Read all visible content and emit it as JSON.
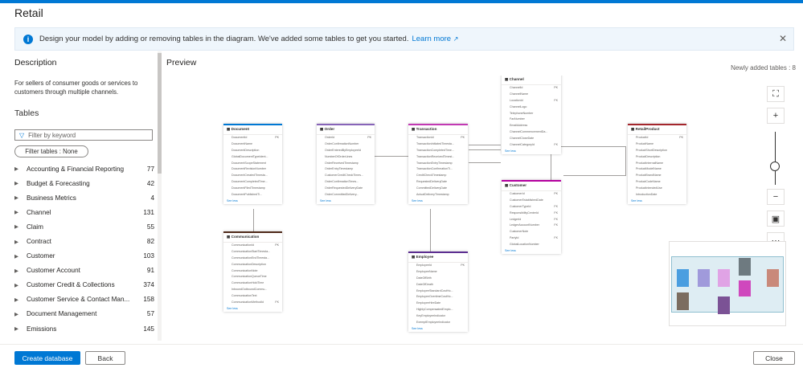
{
  "window": {
    "title": "Retail"
  },
  "banner": {
    "text": "Design your model by adding or removing tables in the diagram. We've added some tables to get you started.",
    "link": "Learn more",
    "link_icon": "external-link-icon",
    "close": "✕"
  },
  "description": {
    "heading": "Description",
    "text": "For sellers of consumer goods or services to customers through multiple channels."
  },
  "tables": {
    "heading": "Tables",
    "filter_placeholder": "Filter by keyword",
    "filter_pill": "Filter tables : None",
    "items": [
      {
        "name": "Accounting & Financial Reporting",
        "count": "77"
      },
      {
        "name": "Budget & Forecasting",
        "count": "42"
      },
      {
        "name": "Business Metrics",
        "count": "4"
      },
      {
        "name": "Channel",
        "count": "131"
      },
      {
        "name": "Claim",
        "count": "55"
      },
      {
        "name": "Contract",
        "count": "82"
      },
      {
        "name": "Customer",
        "count": "103"
      },
      {
        "name": "Customer Account",
        "count": "91"
      },
      {
        "name": "Customer Credit & Collections",
        "count": "374"
      },
      {
        "name": "Customer Service & Contact Man...",
        "count": "158"
      },
      {
        "name": "Document Management",
        "count": "57"
      },
      {
        "name": "Emissions",
        "count": "145"
      }
    ]
  },
  "preview": {
    "heading": "Preview",
    "newly_added": "Newly added tables : 8",
    "see_less": "See less",
    "cards": {
      "document": {
        "title": "Document",
        "fields": [
          {
            "n": "DocumentId",
            "k": "PK"
          },
          {
            "n": "DocumentName",
            "k": ""
          },
          {
            "n": "DocumentDescription",
            "k": ""
          },
          {
            "n": "GlobalDocumentTypeIdent...",
            "k": ""
          },
          {
            "n": "DocumentScopeStatement",
            "k": ""
          },
          {
            "n": "DocumentRevisionNumber",
            "k": ""
          },
          {
            "n": "DocumentCreatedTimesta...",
            "k": ""
          },
          {
            "n": "DocumentCompletedTime...",
            "k": ""
          },
          {
            "n": "DocumentFiledTimestamp",
            "k": ""
          },
          {
            "n": "DocumentPublishedTi...",
            "k": ""
          }
        ]
      },
      "order": {
        "title": "Order",
        "fields": [
          {
            "n": "OrderId",
            "k": "PK"
          },
          {
            "n": "OrderConfirmationNumber",
            "k": ""
          },
          {
            "n": "OrderEnteredByEmployeeId",
            "k": ""
          },
          {
            "n": "NumberOfOrderLines",
            "k": ""
          },
          {
            "n": "OrderReceivedTimestamp",
            "k": ""
          },
          {
            "n": "OrderEntryTimestamp",
            "k": ""
          },
          {
            "n": "CustomerCreditCheckTimes...",
            "k": ""
          },
          {
            "n": "OrderConfirmationTimes...",
            "k": ""
          },
          {
            "n": "OrderRequestedDeliveryDate",
            "k": ""
          },
          {
            "n": "OrderCommittedDelivery...",
            "k": ""
          }
        ]
      },
      "transaction": {
        "title": "Transaction",
        "fields": [
          {
            "n": "TransactionId",
            "k": "PK"
          },
          {
            "n": "TransactionInitiatedTimesta...",
            "k": ""
          },
          {
            "n": "TransactionCompletedTime...",
            "k": ""
          },
          {
            "n": "TransactionReceivedTimest...",
            "k": ""
          },
          {
            "n": "TransactionEntryTimestamp",
            "k": ""
          },
          {
            "n": "TransactionConfirmationTi...",
            "k": ""
          },
          {
            "n": "CreditCheckTimestamp",
            "k": ""
          },
          {
            "n": "RequestedDeliveryDate",
            "k": ""
          },
          {
            "n": "CommittedDeliveryDate",
            "k": ""
          },
          {
            "n": "ActualDeliveryTimestamp",
            "k": ""
          }
        ]
      },
      "channel": {
        "title": "Channel",
        "fields": [
          {
            "n": "ChannelId",
            "k": "PK"
          },
          {
            "n": "ChannelName",
            "k": ""
          },
          {
            "n": "LocationId",
            "k": "FK"
          },
          {
            "n": "ChannelLogo",
            "k": ""
          },
          {
            "n": "TelephoneNumber",
            "k": ""
          },
          {
            "n": "FaxNumber",
            "k": ""
          },
          {
            "n": "EmailAddress",
            "k": ""
          },
          {
            "n": "ChannelCommencementDa...",
            "k": ""
          },
          {
            "n": "ChannelCloseDate",
            "k": ""
          },
          {
            "n": "ChannelCategoryId",
            "k": "FK"
          }
        ]
      },
      "retailproduct": {
        "title": "RetailProduct",
        "fields": [
          {
            "n": "ProductId",
            "k": "PK"
          },
          {
            "n": "ProductName",
            "k": ""
          },
          {
            "n": "ProductShortDescription",
            "k": ""
          },
          {
            "n": "ProductDescription",
            "k": ""
          },
          {
            "n": "ProductInternalName",
            "k": ""
          },
          {
            "n": "ProductModelName",
            "k": ""
          },
          {
            "n": "ProductBrandName",
            "k": ""
          },
          {
            "n": "ProductCodeName",
            "k": ""
          },
          {
            "n": "ProductIntendedUse",
            "k": ""
          },
          {
            "n": "IntroductionDate",
            "k": ""
          }
        ]
      },
      "customer": {
        "title": "Customer",
        "fields": [
          {
            "n": "CustomerId",
            "k": "PK"
          },
          {
            "n": "CustomerEstablishedDate",
            "k": ""
          },
          {
            "n": "CustomerTypeId",
            "k": "FK"
          },
          {
            "n": "ResponsibilityCenterId",
            "k": "FK"
          },
          {
            "n": "LedgerId",
            "k": "FK"
          },
          {
            "n": "LedgerAccountNumber",
            "k": "FK"
          },
          {
            "n": "CustomerNote",
            "k": ""
          },
          {
            "n": "PartyId",
            "k": "FK"
          },
          {
            "n": "GlobalLocationNumber",
            "k": ""
          }
        ]
      },
      "communication": {
        "title": "Communication",
        "fields": [
          {
            "n": "CommunicationId",
            "k": "PK"
          },
          {
            "n": "CommunicationStartTimesta...",
            "k": ""
          },
          {
            "n": "CommunicationEndTimesta...",
            "k": ""
          },
          {
            "n": "CommunicationDescription",
            "k": ""
          },
          {
            "n": "CommunicationNote",
            "k": ""
          },
          {
            "n": "CommunicationQueueTime",
            "k": ""
          },
          {
            "n": "CommunicationHoldTime",
            "k": ""
          },
          {
            "n": "InboundOutboundCommu...",
            "k": ""
          },
          {
            "n": "CommunicationText",
            "k": ""
          },
          {
            "n": "CommunicationMethodId",
            "k": "FK"
          }
        ]
      },
      "employee": {
        "title": "Employee",
        "fields": [
          {
            "n": "EmployeeId",
            "k": "PK"
          },
          {
            "n": "EmployeeName",
            "k": ""
          },
          {
            "n": "DateOfBirth",
            "k": ""
          },
          {
            "n": "DateOfDeath",
            "k": ""
          },
          {
            "n": "EmployeeStandardCostHo...",
            "k": ""
          },
          {
            "n": "EmployeeOvertimeCostHo...",
            "k": ""
          },
          {
            "n": "EmployeeHireDate",
            "k": ""
          },
          {
            "n": "HighlyCompensatedEmplo...",
            "k": ""
          },
          {
            "n": "KeyEmployeeIndicator",
            "k": ""
          },
          {
            "n": "ExemptEmployeeIndicator",
            "k": ""
          }
        ]
      }
    },
    "controls": {
      "fit": "⛶",
      "zoom_in": "+",
      "zoom_out": "−",
      "minimap": "▣",
      "more": "⋯"
    },
    "zoom_level": 0.35
  },
  "footer": {
    "create": "Create database",
    "back": "Back",
    "close": "Close"
  },
  "colors": {
    "accent": "#0078d4",
    "document": "#0078d4",
    "order": "#8764b8",
    "transaction": "#c239b3",
    "channel": "#7a7574",
    "retailproduct": "#a4262c",
    "customer": "#b4009e",
    "communication": "#4f2a1a",
    "employee": "#5c2e91"
  }
}
